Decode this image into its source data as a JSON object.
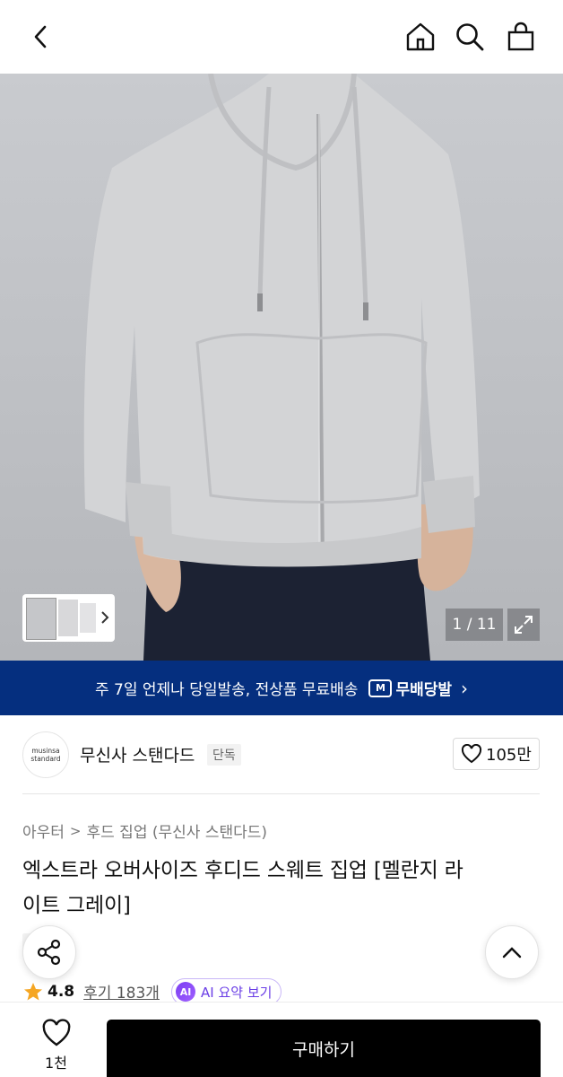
{
  "header": {
    "back_icon": "chevron-left-icon",
    "home_icon": "home-icon",
    "search_icon": "search-icon",
    "cart_icon": "shopping-bag-icon"
  },
  "gallery": {
    "counter": "1 / 11",
    "expand_icon": "expand-icon",
    "thumb_more_icon": "chevron-right-icon"
  },
  "banner": {
    "text": "주 7일 언제나 당일발송, 전상품 무료배송",
    "logo_mark": "M",
    "logo_label": "무배당발",
    "arrow": "›",
    "color": "#052f7f"
  },
  "brand": {
    "logo_line1": "musinsa",
    "logo_line2": "standard",
    "name": "무신사 스탠다드",
    "tag": "단독",
    "likes": "105만"
  },
  "product": {
    "breadcrumb": [
      "아우터",
      "후드 집업 (무신사 스탠다드)"
    ],
    "title_line1": "엑스트라 오버사이즈 후디드 스웨트 집업 [멜란지 라",
    "title_line2": "이트 그레이]",
    "exclusive_tag": "단독",
    "rating": "4.8",
    "reviews": "후기 183개",
    "ai_badge": "AI",
    "ai_label": "AI 요약 보기",
    "star_color": "#f5a623"
  },
  "bottom": {
    "wish_count": "1천",
    "buy_label": "구매하기"
  }
}
